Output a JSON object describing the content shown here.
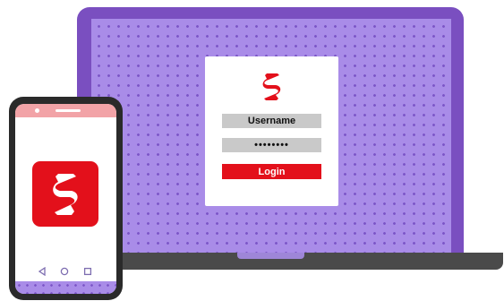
{
  "login": {
    "username_label": "Username",
    "password_mask": "••••••••",
    "button_label": "Login"
  },
  "icons": {
    "brand": "scotiabank-s-logo-icon",
    "nav_back": "triangle-back-icon",
    "nav_home": "circle-home-icon",
    "nav_recent": "square-recent-icon"
  },
  "colors": {
    "brand_red": "#e3101b",
    "laptop_frame": "#7a4fc0",
    "screen_bg": "#a98ce8",
    "screen_dots": "#7b55c7",
    "field_gray": "#c9c9c9",
    "phone_status": "#f2a3a7"
  }
}
